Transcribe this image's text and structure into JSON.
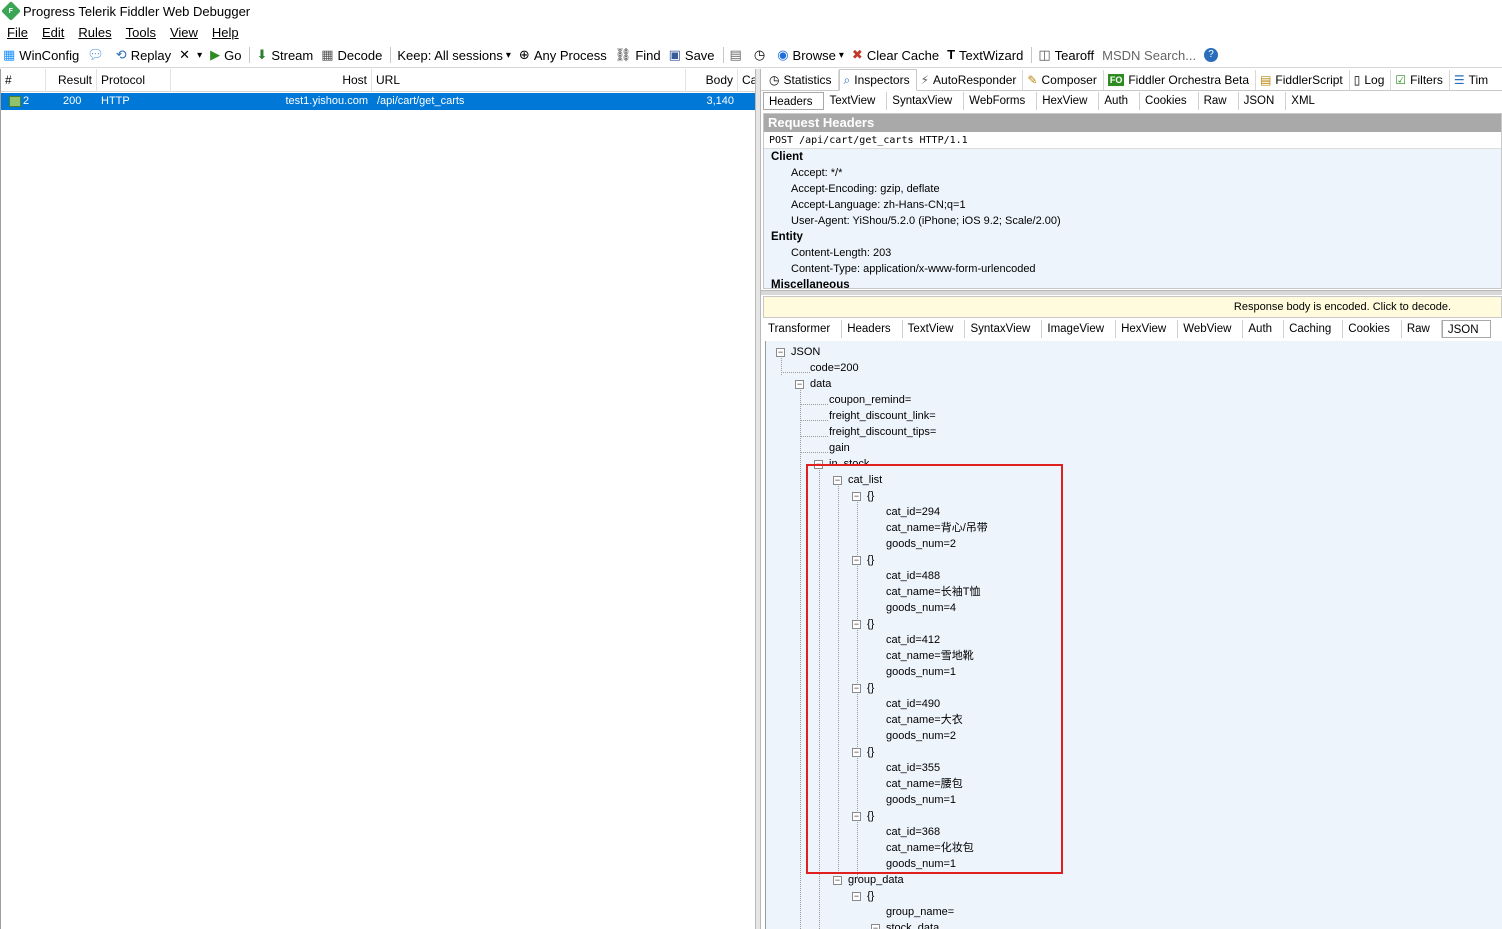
{
  "window": {
    "title": "Progress Telerik Fiddler Web Debugger",
    "logo_letter": "F"
  },
  "menu": [
    "File",
    "Edit",
    "Rules",
    "Tools",
    "View",
    "Help"
  ],
  "toolbar": {
    "winconfig": "WinConfig",
    "replay": "Replay",
    "go": "Go",
    "stream": "Stream",
    "decode": "Decode",
    "keep": "Keep: All sessions",
    "any_process": "Any Process",
    "find": "Find",
    "save": "Save",
    "browse": "Browse",
    "clear_cache": "Clear Cache",
    "textwizard": "TextWizard",
    "tearoff": "Tearoff",
    "msdn_search": "MSDN Search..."
  },
  "sessions": {
    "columns": [
      "#",
      "Result",
      "Protocol",
      "Host",
      "URL",
      "Body",
      "Ca"
    ],
    "rows": [
      {
        "num": "2",
        "result": "200",
        "protocol": "HTTP",
        "host": "test1.yishou.com",
        "url": "/api/cart/get_carts",
        "body": "3,140"
      }
    ]
  },
  "inspector_tabs": [
    "Statistics",
    "Inspectors",
    "AutoResponder",
    "Composer",
    "Fiddler Orchestra Beta",
    "FiddlerScript",
    "Log",
    "Filters",
    "Tim"
  ],
  "fo_badge": "FO",
  "request_tabs": [
    "Headers",
    "TextView",
    "SyntaxView",
    "WebForms",
    "HexView",
    "Auth",
    "Cookies",
    "Raw",
    "JSON",
    "XML"
  ],
  "request_headers": {
    "title": "Request Headers",
    "request_line": "POST /api/cart/get_carts HTTP/1.1",
    "groups": [
      {
        "name": "Client",
        "headers": [
          "Accept: */*",
          "Accept-Encoding: gzip, deflate",
          "Accept-Language: zh-Hans-CN;q=1",
          "User-Agent: YiShou/5.2.0 (iPhone; iOS 9.2; Scale/2.00)"
        ]
      },
      {
        "name": "Entity",
        "headers": [
          "Content-Length: 203",
          "Content-Type: application/x-www-form-urlencoded"
        ]
      },
      {
        "name": "Miscellaneous",
        "headers": []
      }
    ]
  },
  "response_notice": "Response body is encoded. Click to decode.",
  "response_tabs": [
    "Transformer",
    "Headers",
    "TextView",
    "SyntaxView",
    "ImageView",
    "HexView",
    "WebView",
    "Auth",
    "Caching",
    "Cookies",
    "Raw",
    "JSON"
  ],
  "json_tree": {
    "root": "JSON",
    "code": "code=200",
    "data": "data",
    "data_fields": [
      "coupon_remind=",
      "freight_discount_link=",
      "freight_discount_tips=",
      "gain"
    ],
    "in_stock": "in_stock",
    "cat_list": "cat_list",
    "cats": [
      {
        "id": "cat_id=294",
        "name": "cat_name=背心/吊带",
        "num": "goods_num=2"
      },
      {
        "id": "cat_id=488",
        "name": "cat_name=长袖T恤",
        "num": "goods_num=4"
      },
      {
        "id": "cat_id=412",
        "name": "cat_name=雪地靴",
        "num": "goods_num=1"
      },
      {
        "id": "cat_id=490",
        "name": "cat_name=大衣",
        "num": "goods_num=2"
      },
      {
        "id": "cat_id=355",
        "name": "cat_name=腰包",
        "num": "goods_num=1"
      },
      {
        "id": "cat_id=368",
        "name": "cat_name=化妆包",
        "num": "goods_num=1"
      }
    ],
    "object_label": "{}",
    "group_data": "group_data",
    "group_name": "group_name=",
    "stock_data": "stock_data"
  }
}
